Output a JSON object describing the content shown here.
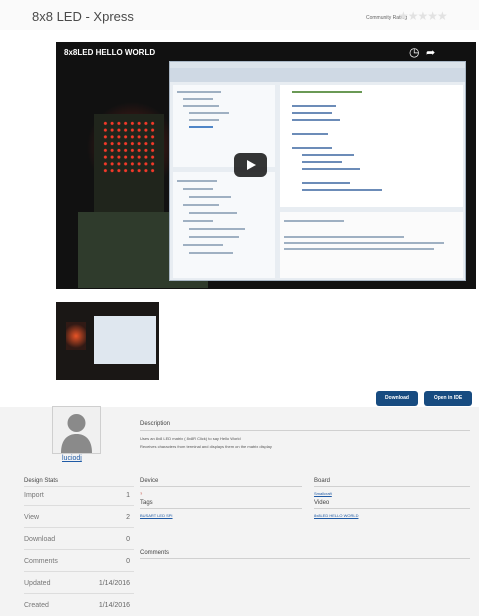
{
  "page": {
    "title": "8x8 LED - Xpress",
    "community_rating_label": "Community Rating",
    "stars": "★★★★★"
  },
  "video": {
    "title": "8x8LED HELLO WORLD",
    "clock_icon": "clock-icon",
    "share_icon": "share-icon",
    "play_icon": "play-icon"
  },
  "buttons": {
    "download": "Download",
    "open_in_ide": "Open in IDE"
  },
  "user": {
    "username": "luciodj"
  },
  "description": {
    "heading": "Description",
    "line1": "Uses an 8x8 LED matrix ( 8x8R Click) to say Hello World",
    "line2": "Receives characters from terminal and displays them on the matrix display"
  },
  "details": {
    "device_heading": "Device",
    "device_value": "?",
    "board_heading": "Board",
    "board_value": "Smallcraft",
    "tags_heading": "Tags",
    "tags_value": "BUSART LED SPI",
    "video_heading": "Video",
    "video_value": "8x8LED HELLO WORLD",
    "comments_heading": "Comments"
  },
  "stats": {
    "heading": "Design Stats",
    "rows": [
      {
        "label": "Import",
        "value": "1"
      },
      {
        "label": "View",
        "value": "2"
      },
      {
        "label": "Download",
        "value": "0"
      },
      {
        "label": "Comments",
        "value": "0"
      },
      {
        "label": "Updated",
        "value": "1/14/2016"
      },
      {
        "label": "Created",
        "value": "1/14/2016"
      }
    ]
  }
}
